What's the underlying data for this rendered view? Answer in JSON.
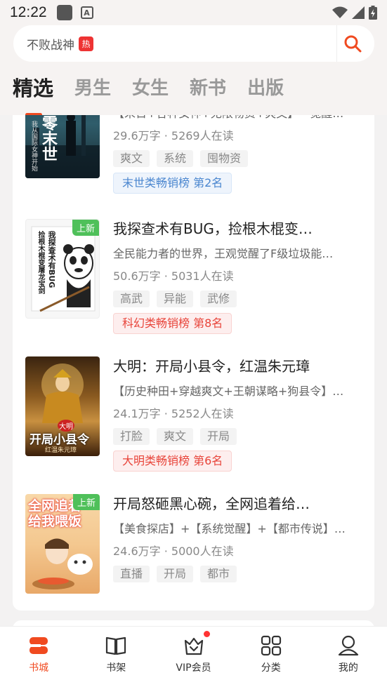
{
  "status_bar": {
    "time": "12:22"
  },
  "search": {
    "text": "不败战神",
    "hot_badge": "热"
  },
  "tabs": [
    {
      "label": "精选",
      "active": true
    },
    {
      "label": "男生"
    },
    {
      "label": "女生"
    },
    {
      "label": "新书"
    },
    {
      "label": "出版"
    }
  ],
  "books": [
    {
      "cover_text": "零末世",
      "cover_sub": "我从国际女神开始",
      "title": "",
      "desc": "【末日+各种女神+无限物资+爽文】一觉醒…",
      "meta": "29.6万字 · 5269人在读",
      "tags": [
        "爽文",
        "系统",
        "囤物资"
      ],
      "rank": "末世类畅销榜  第2名",
      "rank_color": "#4a86cf"
    },
    {
      "cover_text": "我探查术有BUG",
      "cover_sub": "捡根木棍变屠龙宝剑",
      "new_badge": "上新",
      "title": "我探查术有BUG，捡根木棍变…",
      "desc": "全民能力者的世界，王观觉醒了F级垃圾能…",
      "meta": "50.6万字 · 5031人在读",
      "tags": [
        "高武",
        "异能",
        "武修"
      ],
      "rank": "科幻类畅销榜  第8名",
      "rank_color": "#e8443a"
    },
    {
      "cover_text": "开局小县令",
      "cover_sub": "红温朱元璋",
      "cover_top": "大明",
      "title": "大明：开局小县令，红温朱元璋",
      "desc": "【历史种田+穿越爽文+王朝谋略+狗县令】…",
      "meta": "24.1万字 · 5252人在读",
      "tags": [
        "打脸",
        "爽文",
        "开局"
      ],
      "rank": "大明类畅销榜  第6名",
      "rank_color": "#e8443a"
    },
    {
      "cover_text": "全网追着给我喂饭",
      "new_badge": "上新",
      "title": "开局怒砸黑心碗，全网追着给…",
      "desc": "【美食探店】+【系统觉醒】+【都市传说】…",
      "meta": "24.6万字 · 5000人在读",
      "tags": [
        "直播",
        "开局",
        "都市"
      ]
    }
  ],
  "bottom_nav": [
    {
      "label": "书城",
      "icon": "bookstore-icon",
      "active": true
    },
    {
      "label": "书架",
      "icon": "bookshelf-icon"
    },
    {
      "label": "VIP会员",
      "icon": "vip-crown-icon",
      "dot": true
    },
    {
      "label": "分类",
      "icon": "category-grid-icon"
    },
    {
      "label": "我的",
      "icon": "profile-icon"
    }
  ],
  "colors": {
    "accent": "#f04a20",
    "new_badge": "#4fc05a"
  }
}
